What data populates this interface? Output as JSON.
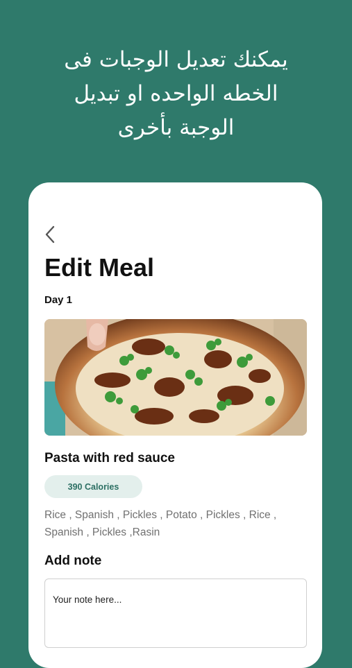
{
  "banner": {
    "headline_line1": "يمكنك تعديل الوجبات فى",
    "headline_line2": "الخطه الواحده او تبديل",
    "headline_line3": "الوجبة بأخرى"
  },
  "screen": {
    "back_icon": "chevron-left-icon",
    "title": "Edit Meal",
    "day_label": "Day 1"
  },
  "meal": {
    "image_icon": "pizza-photo",
    "name": "Pasta with red sauce",
    "calories": "390 Calories",
    "ingredients": "Rice , Spanish , Pickles , Potato , Pickles , Rice , Spanish , Pickles ,Rasin"
  },
  "note": {
    "label": "Add note",
    "placeholder": "Your note here..."
  },
  "colors": {
    "background": "#2f7a6b",
    "badge_bg": "#e3efec",
    "badge_text": "#2c6f63"
  }
}
